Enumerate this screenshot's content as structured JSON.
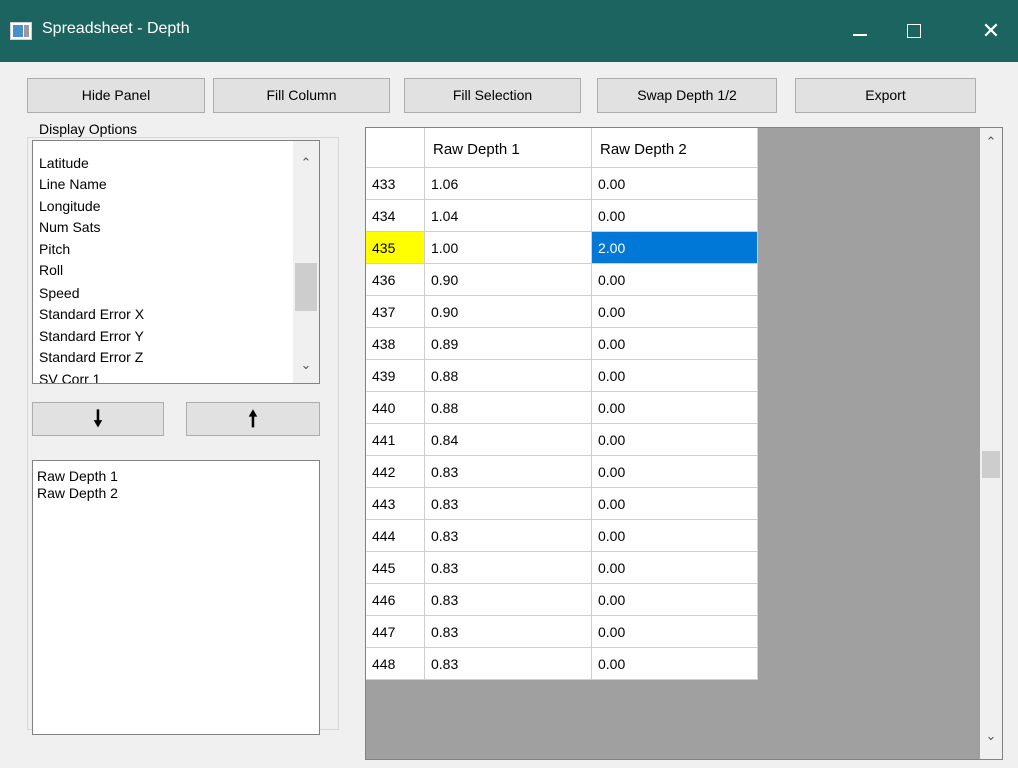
{
  "window": {
    "title": "Spreadsheet - Depth",
    "minimize_icon": "minimize-icon",
    "maximize_icon": "maximize-icon",
    "close_label": "✕"
  },
  "toolbar": {
    "hide_panel": "Hide Panel",
    "fill_column": "Fill Column",
    "fill_selection": "Fill Selection",
    "swap_depth": "Swap Depth 1/2",
    "export": "Export"
  },
  "display_options": {
    "label": "Display Options",
    "available": [
      "Latitude",
      "Line Name",
      "Longitude",
      "Num Sats",
      "Pitch",
      "Roll",
      "Speed",
      "Standard Error X",
      "Standard Error Y",
      "Standard Error Z",
      "SV Corr 1"
    ],
    "move_down_glyph": "🠗",
    "move_up_glyph": "🠕",
    "selected": [
      "Raw Depth 1",
      "Raw Depth 2"
    ]
  },
  "grid": {
    "columns": [
      "Raw Depth 1",
      "Raw Depth 2"
    ],
    "rows": [
      {
        "index": "433",
        "values": [
          "1.06",
          "0.00"
        ]
      },
      {
        "index": "434",
        "values": [
          "1.04",
          "0.00"
        ]
      },
      {
        "index": "435",
        "values": [
          "1.00",
          "2.00"
        ],
        "current": true,
        "selected_col": 1
      },
      {
        "index": "436",
        "values": [
          "0.90",
          "0.00"
        ]
      },
      {
        "index": "437",
        "values": [
          "0.90",
          "0.00"
        ]
      },
      {
        "index": "438",
        "values": [
          "0.89",
          "0.00"
        ]
      },
      {
        "index": "439",
        "values": [
          "0.88",
          "0.00"
        ]
      },
      {
        "index": "440",
        "values": [
          "0.88",
          "0.00"
        ]
      },
      {
        "index": "441",
        "values": [
          "0.84",
          "0.00"
        ]
      },
      {
        "index": "442",
        "values": [
          "0.83",
          "0.00"
        ]
      },
      {
        "index": "443",
        "values": [
          "0.83",
          "0.00"
        ]
      },
      {
        "index": "444",
        "values": [
          "0.83",
          "0.00"
        ]
      },
      {
        "index": "445",
        "values": [
          "0.83",
          "0.00"
        ]
      },
      {
        "index": "446",
        "values": [
          "0.83",
          "0.00"
        ]
      },
      {
        "index": "447",
        "values": [
          "0.83",
          "0.00"
        ]
      },
      {
        "index": "448",
        "values": [
          "0.83",
          "0.00"
        ]
      }
    ]
  },
  "colors": {
    "titlebar": "#1c6460",
    "current_row_marker": "#ffff00",
    "selection": "#0078d7"
  }
}
